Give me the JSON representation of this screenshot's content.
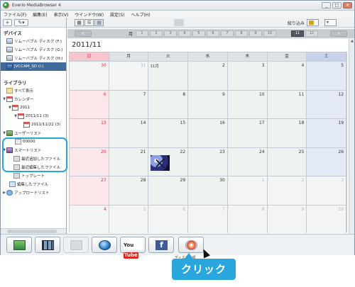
{
  "window": {
    "title": "Everio MediaBrowser 4",
    "buttons": {
      "minimize": "_",
      "maximize": "□",
      "close": "✕"
    }
  },
  "menu": [
    "ファイル(F)",
    "編集(E)",
    "表示(V)",
    "ウインドウ(W)",
    "設定(S)",
    "ヘルプ(H)"
  ],
  "left_toolbar": {
    "add": "+",
    "tools": "✎▾"
  },
  "devices": {
    "heading": "デバイス",
    "items": [
      {
        "label": "リムーバブル ディスク (F:)"
      },
      {
        "label": "リムーバブル ディスク (G:)"
      },
      {
        "label": "リムーバブル ディスク (H:)"
      },
      {
        "label": "JVCCAM_SD (I:)"
      }
    ]
  },
  "library": {
    "heading": "ライブラリ",
    "all": "すべて表示",
    "calendar": "カレンダー",
    "year": "2011",
    "month": "2011/11 (3)",
    "day": "2011/11/22 (3)",
    "user_list": "ユーザーリスト",
    "user_list_item": "00000",
    "smart_list": "スマートリスト",
    "recent_added": "最近追加したファイル",
    "recent_edited": "最近編集したファイル",
    "top_rated": "トップレート",
    "edited_files": "編集したファイル",
    "upload_list": "アップロードリスト"
  },
  "right_toolbar": {
    "narrow_label": "絞り込み",
    "sort_label": "▾"
  },
  "month_bar": {
    "prev": "<",
    "next": ">",
    "month_label": "月",
    "months": [
      "1",
      "2",
      "3",
      "4",
      "5",
      "6",
      "7",
      "8",
      "9",
      "10",
      "11",
      "12"
    ],
    "current_month": "11"
  },
  "calendar": {
    "title": "2011/11",
    "weekdays": [
      "日",
      "月",
      "火",
      "水",
      "木",
      "金",
      "土"
    ],
    "cells": [
      [
        "30",
        "31",
        "1",
        "2",
        "3",
        "4",
        "5"
      ],
      [
        "6",
        "7",
        "8",
        "9",
        "10",
        "11",
        "12"
      ],
      [
        "13",
        "14",
        "15",
        "16",
        "17",
        "18",
        "19"
      ],
      [
        "20",
        "21",
        "22",
        "23",
        "24",
        "25",
        "26"
      ],
      [
        "27",
        "28",
        "29",
        "30",
        "1",
        "2",
        "3"
      ],
      [
        "4",
        "5",
        "6",
        "7",
        "8",
        "9",
        "10"
      ]
    ],
    "tue_first_label": "11月"
  },
  "bottom_bar": {
    "youtube_left": "You",
    "youtube_right": "Tube",
    "facebook": "f",
    "disc_label": "ディスク作成"
  },
  "callout": {
    "text": "クリック"
  },
  "colors": {
    "accent": "#29a6dc",
    "selected_row": "#3e6a9c",
    "sunday": "#f6c6cf",
    "saturday": "#c8d3ea"
  }
}
